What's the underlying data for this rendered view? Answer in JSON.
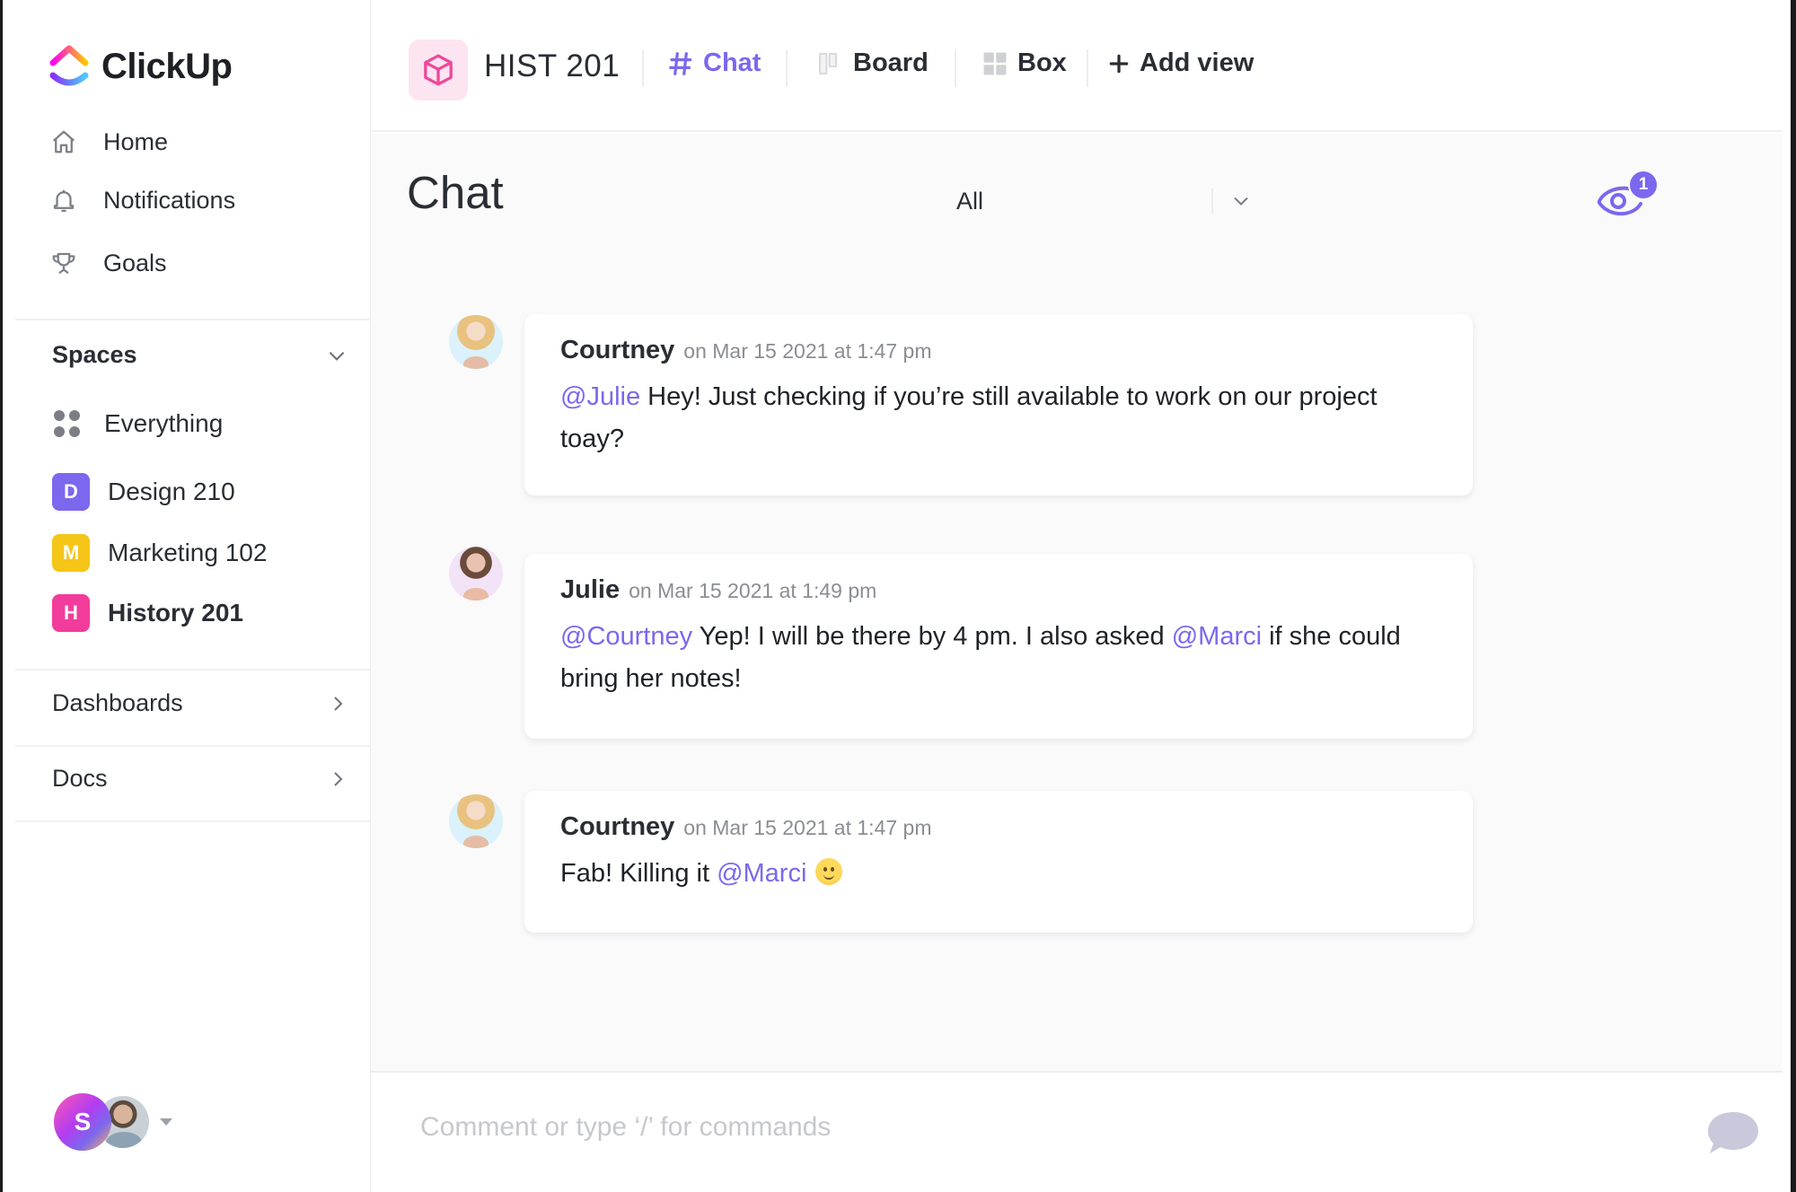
{
  "app": {
    "brand": "ClickUp",
    "accent_color": "#7b68ee"
  },
  "sidebar": {
    "nav": [
      {
        "label": "Home",
        "icon": "home-icon"
      },
      {
        "label": "Notifications",
        "icon": "bell-icon"
      },
      {
        "label": "Goals",
        "icon": "trophy-icon"
      }
    ],
    "spaces_label": "Spaces",
    "spaces": [
      {
        "label": "Everything",
        "icon": "grid-dots-icon"
      },
      {
        "label": "Design 210",
        "letter": "D",
        "color": "#7b68ee"
      },
      {
        "label": "Marketing 102",
        "letter": "M",
        "color": "#f5c518"
      },
      {
        "label": "History 201",
        "letter": "H",
        "color": "#f23c9c",
        "active": true
      }
    ],
    "sections": [
      {
        "label": "Dashboards"
      },
      {
        "label": "Docs"
      }
    ],
    "user": {
      "initial": "S"
    }
  },
  "header": {
    "space_name": "HIST 201",
    "views": [
      {
        "label": "Chat",
        "icon": "hash-icon",
        "active": true
      },
      {
        "label": "Board",
        "icon": "board-icon"
      },
      {
        "label": "Box",
        "icon": "box-grid-icon"
      }
    ],
    "add_view_label": "Add view"
  },
  "chat": {
    "title": "Chat",
    "filter": {
      "selected": "All"
    },
    "watchers_count": "1",
    "messages": [
      {
        "author": "Courtney",
        "timestamp": "on Mar 15 2021 at 1:47 pm",
        "parts": [
          {
            "mention": "@Julie"
          },
          {
            "text": " Hey! Just checking if you’re still available to work on our project toay?"
          }
        ]
      },
      {
        "author": "Julie",
        "timestamp": "on Mar 15 2021 at 1:49 pm",
        "parts": [
          {
            "mention": "@Courtney"
          },
          {
            "text": " Yep! I will be there by 4 pm. I also asked "
          },
          {
            "mention": "@Marci"
          },
          {
            "text": " if she could bring her notes!"
          }
        ]
      },
      {
        "author": "Courtney",
        "timestamp": "on Mar 15 2021 at 1:47 pm",
        "parts": [
          {
            "text": "Fab! Killing it "
          },
          {
            "mention": "@Marci"
          },
          {
            "emoji": "slightly-smiling-face"
          }
        ]
      }
    ]
  },
  "composer": {
    "placeholder": "Comment or type ‘/’ for commands",
    "value": ""
  }
}
